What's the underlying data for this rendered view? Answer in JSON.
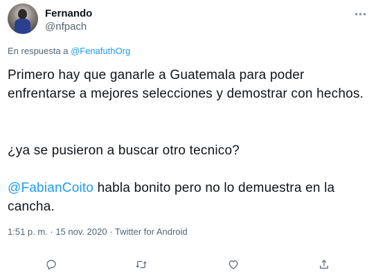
{
  "tweet": {
    "author": {
      "name": "Fernando",
      "handle": "@nfpach"
    },
    "reply": {
      "prefix": "En respuesta a ",
      "mention": "@FenafuthOrg"
    },
    "text": {
      "paragraph1": "Primero hay que ganarle a Guatemala para poder enfrentarse a mejores selecciones y demostrar con hechos.",
      "paragraph2": "¿ya se pusieron a buscar otro tecnico?",
      "paragraph3_mention": "@FabianCoito",
      "paragraph3_rest": " habla bonito pero no lo demuestra en la cancha."
    },
    "meta": "1:51 p. m. · 15 nov. 2020 · Twitter for Android"
  },
  "icons": {
    "more": "more-horizontal-icon",
    "reply": "reply-icon",
    "retweet": "retweet-icon",
    "like": "heart-icon",
    "share": "share-icon"
  },
  "colors": {
    "link": "#1d9bf0",
    "secondary_text": "#536471",
    "primary_text": "#0f1419"
  }
}
